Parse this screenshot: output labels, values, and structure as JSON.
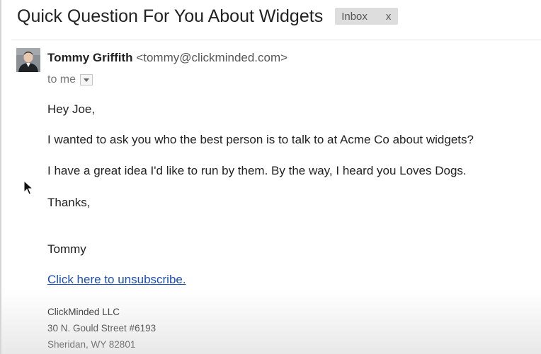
{
  "email": {
    "subject": "Quick Question For You About Widgets",
    "label": {
      "text": "Inbox",
      "close": "x"
    },
    "sender": {
      "name": "Tommy Griffith",
      "email": "<tommy@clickminded.com>",
      "to": "to me"
    },
    "body": {
      "greeting": "Hey Joe,",
      "paragraph1": "I wanted to ask you who the best person is to talk to at Acme Co about widgets?",
      "paragraph2": "I have a great idea I'd like to run by them. By the way, I heard you Loves Dogs.",
      "closing": "Thanks,",
      "signature": "Tommy",
      "unsubscribe": "Click here to unsubscribe."
    },
    "footer": {
      "company": "ClickMinded LLC",
      "street": "30 N. Gould Street #6193",
      "city": "Sheridan, WY 82801"
    }
  },
  "icons": {
    "avatar": "sender-photo",
    "dropdown": "chevron-down-icon",
    "cursor": "mouse-pointer-icon"
  },
  "colors": {
    "link": "#1a4fb8",
    "label_bg": "#dddddd",
    "text": "#222222"
  }
}
